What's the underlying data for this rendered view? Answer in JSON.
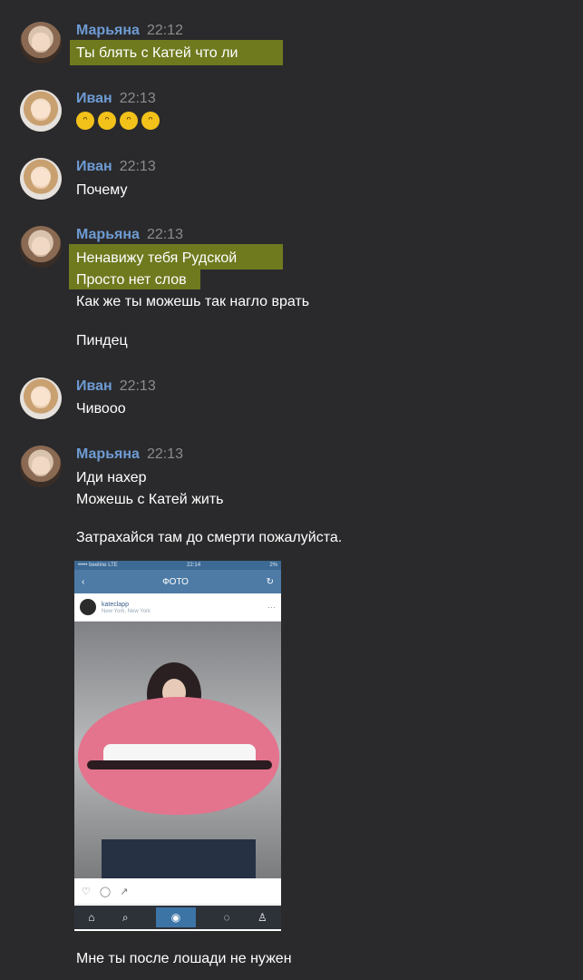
{
  "messages": [
    {
      "author": "Марьяна",
      "time": "22:12",
      "lines": [
        "Ты блять с Катей что ли"
      ]
    },
    {
      "author": "Иван",
      "time": "22:13",
      "emoji_count": 4
    },
    {
      "author": "Иван",
      "time": "22:13",
      "lines": [
        "Почему"
      ]
    },
    {
      "author": "Марьяна",
      "time": "22:13",
      "lines": [
        "Ненавижу тебя Рудской",
        "Просто нет слов",
        "Как же ты можешь так нагло врать",
        "Пиндец"
      ]
    },
    {
      "author": "Иван",
      "time": "22:13",
      "lines": [
        "Чивооо"
      ]
    },
    {
      "author": "Марьяна",
      "time": "22:13",
      "lines": [
        "Иди нахер",
        "Можешь с Катей жить",
        "Затрахайся там до смерти пожалуйста.",
        "Мне ты после лошади не нужен"
      ]
    }
  ],
  "screenshot": {
    "status_left": "••••• beeline LTE",
    "status_time": "22:14",
    "status_right": "2%",
    "nav_back": "‹",
    "nav_title": "ФОТО",
    "nav_refresh": "↻",
    "username": "kateclapp",
    "location": "New York, New York",
    "menu": "···",
    "actions": [
      "♡",
      "◯",
      "↗"
    ],
    "tabs": [
      "⌂",
      "⌕",
      "◉",
      "◌",
      "♙"
    ]
  },
  "colors": {
    "background": "#2a2a2c",
    "name": "#6e9bd3",
    "time": "#8c8c8c",
    "highlight": "#6f7a1f"
  }
}
